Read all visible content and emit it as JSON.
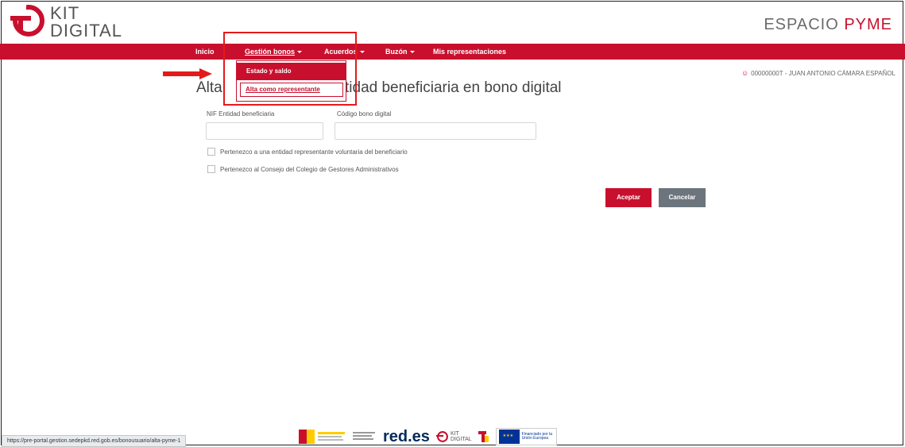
{
  "header": {
    "logo_line1": "KIT",
    "logo_line2": "DIGITAL",
    "brand_part1": "ESPACIO",
    "brand_part2": "PYME"
  },
  "nav": {
    "items": [
      {
        "label": "Inicio"
      },
      {
        "label": "Gestión bonos"
      },
      {
        "label": "Acuerdos"
      },
      {
        "label": "Buzón"
      },
      {
        "label": "Mis representaciones"
      }
    ]
  },
  "dropdown": {
    "items": [
      {
        "label": "Estado y saldo"
      },
      {
        "label": "Alta como representante"
      }
    ]
  },
  "user": {
    "label": "00000000T - JUAN ANTONIO CÁMARA ESPAÑOL"
  },
  "page": {
    "title_start": "Alta",
    "title_end": "tidad beneficiaria en bono digital"
  },
  "form": {
    "nif_label": "NIF Entidad beneficiaria",
    "code_label": "Código bono digital",
    "checkbox1": "Pertenezco a una entidad representante voluntaria del beneficiario",
    "checkbox2": "Pertenezco al Consejo del Colegio de Gestores Administrativos",
    "accept": "Aceptar",
    "cancel": "Cancelar"
  },
  "status_bar": {
    "url": "https://pre-portal.gestion.sedepkd.red.gob.es/bonousuario/alta-pyme-1"
  },
  "footer": {
    "reds_label": "red.es",
    "kit_line1": "KIT",
    "kit_line2": "DIGITAL",
    "eu_text": "Financiado por la Unión Europea"
  },
  "colors": {
    "primary": "#c8102e",
    "secondary": "#6c757d",
    "highlight": "#e41a1a"
  }
}
